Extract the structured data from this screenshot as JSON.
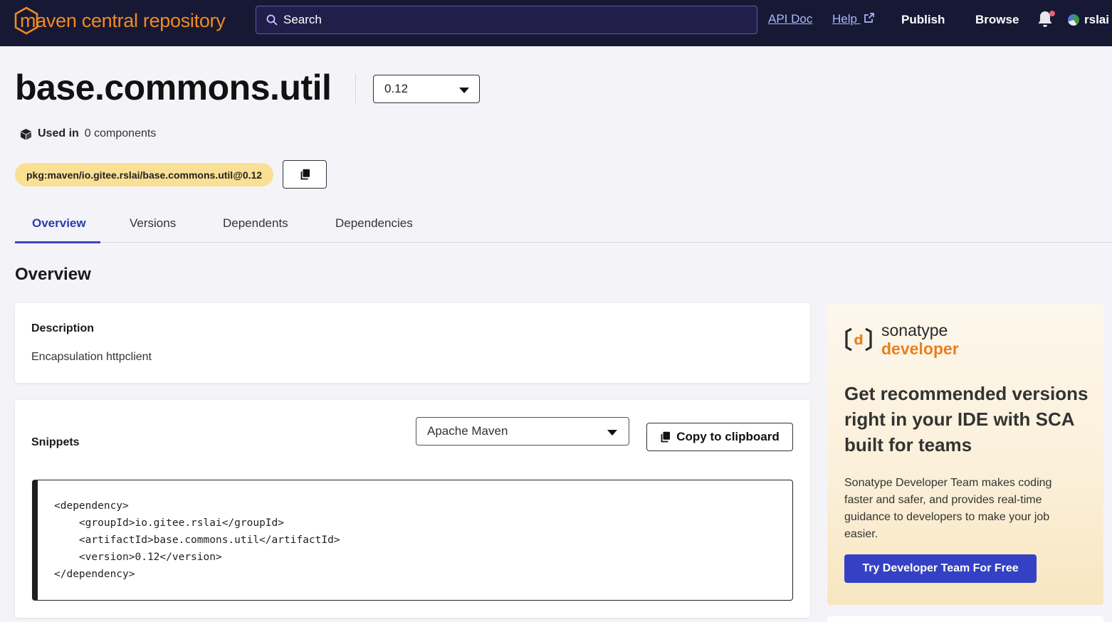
{
  "header": {
    "logo_text": "maven central repository",
    "search_placeholder": "Search",
    "api_doc": "API Doc",
    "help": "Help",
    "publish": "Publish",
    "browse": "Browse",
    "user": "rslai",
    "notification_dot": true
  },
  "component": {
    "name": "base.commons.util",
    "version": "0.12",
    "used_in_label": "Used in",
    "used_in_value": "0 components",
    "purl": "pkg:maven/io.gitee.rslai/base.commons.util@0.12"
  },
  "tabs": [
    {
      "label": "Overview",
      "active": true
    },
    {
      "label": "Versions",
      "active": false
    },
    {
      "label": "Dependents",
      "active": false
    },
    {
      "label": "Dependencies",
      "active": false
    }
  ],
  "overview": {
    "title": "Overview",
    "description_heading": "Description",
    "description_text": "Encapsulation httpclient",
    "snippets_heading": "Snippets",
    "build_tool": "Apache Maven",
    "copy_label": "Copy to clipboard",
    "code_lines": [
      "<dependency>",
      "    <groupId>io.gitee.rslai</groupId>",
      "    <artifactId>base.commons.util</artifactId>",
      "    <version>0.12</version>",
      "</dependency>"
    ]
  },
  "promo": {
    "brand_line1": "sonatype",
    "brand_line2": "developer",
    "headline": "Get recommended versions right in your IDE with SCA built for teams",
    "body": "Sonatype Developer Team makes coding faster and safer, and provides real-time guidance to developers to make your job easier.",
    "cta": "Try Developer Team For Free"
  },
  "colors": {
    "header_bg": "#171833",
    "brand_orange": "#f08a24",
    "accent_blue": "#3746c6",
    "purl_badge": "#f9e094"
  }
}
